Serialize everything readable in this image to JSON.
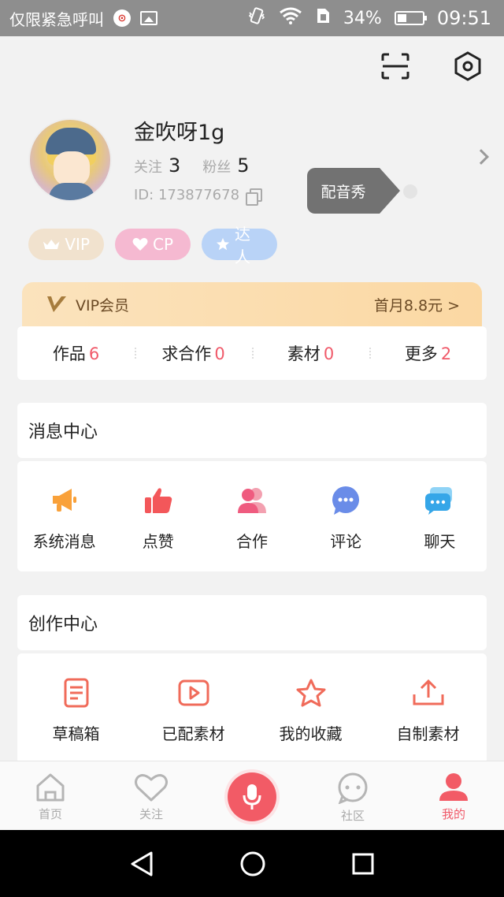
{
  "status_bar": {
    "carrier": "仅限紧急呼叫",
    "battery": "34%",
    "time": "09:51"
  },
  "profile": {
    "username": "金吹呀1g",
    "following_label": "关注",
    "following_count": "3",
    "fans_label": "粉丝",
    "fans_count": "5",
    "id_text": "ID: 173877678",
    "tooltip": "配音秀"
  },
  "badges": [
    {
      "label": "VIP",
      "icon": "crown-icon"
    },
    {
      "label": "CP",
      "icon": "heart-icon"
    },
    {
      "label": "达人",
      "icon": "star-icon"
    }
  ],
  "vip_banner": {
    "title": "VIP会员",
    "price": "首月8.8元 >"
  },
  "tabs": [
    {
      "label": "作品",
      "count": "6"
    },
    {
      "label": "求合作",
      "count": "0"
    },
    {
      "label": "素材",
      "count": "0"
    },
    {
      "label": "更多",
      "count": "2"
    }
  ],
  "message_center": {
    "title": "消息中心",
    "items": [
      {
        "label": "系统消息",
        "icon": "megaphone-icon"
      },
      {
        "label": "点赞",
        "icon": "thumbs-up-icon"
      },
      {
        "label": "合作",
        "icon": "users-icon"
      },
      {
        "label": "评论",
        "icon": "comment-icon"
      },
      {
        "label": "聊天",
        "icon": "chat-icon"
      }
    ]
  },
  "creation_center": {
    "title": "创作中心",
    "items": [
      {
        "label": "草稿箱",
        "icon": "draft-icon"
      },
      {
        "label": "已配素材",
        "icon": "video-icon"
      },
      {
        "label": "我的收藏",
        "icon": "star-outline-icon"
      },
      {
        "label": "自制素材",
        "icon": "upload-icon"
      }
    ]
  },
  "bottom_nav": [
    {
      "label": "首页",
      "icon": "home-icon"
    },
    {
      "label": "关注",
      "icon": "heart-outline-icon"
    },
    {
      "label": "",
      "icon": "microphone-icon"
    },
    {
      "label": "社区",
      "icon": "community-icon"
    },
    {
      "label": "我的",
      "icon": "profile-icon"
    }
  ],
  "colors": {
    "accent": "#f05a6a",
    "vip_text": "#6b4a25"
  }
}
